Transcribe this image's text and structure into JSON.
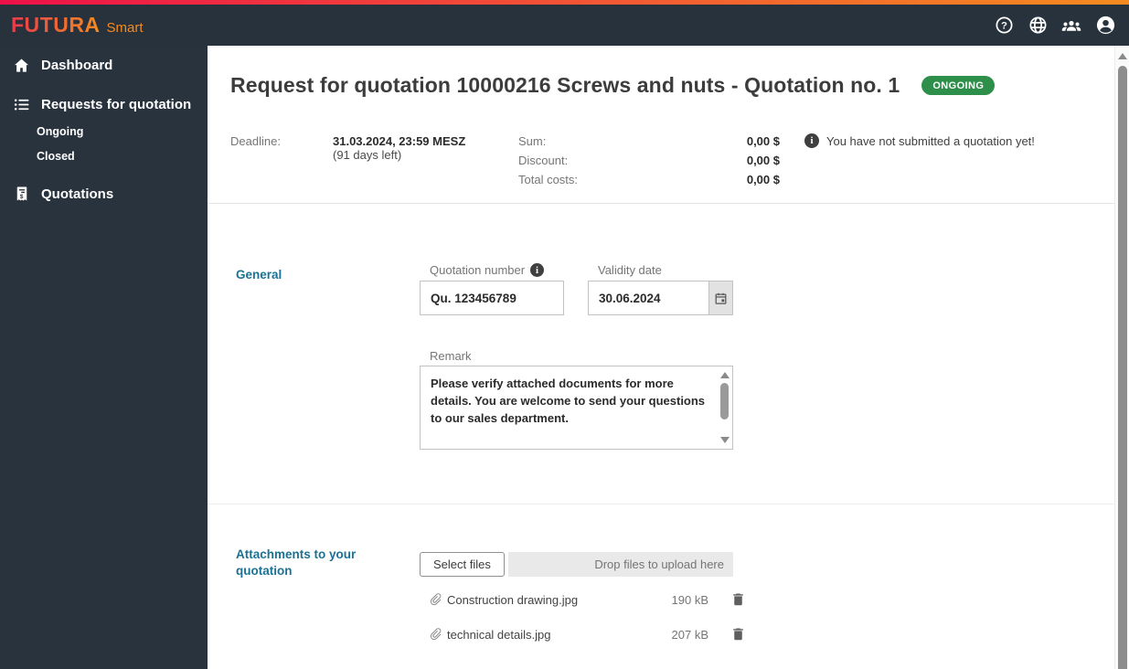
{
  "colors": {
    "topbar_bg": "#28323c",
    "sidebar_bg": "#28333e",
    "gradient_from": "#ee1149",
    "gradient_to": "#f68b1f",
    "brand_orange": "#f68b1f",
    "section_heading_teal": "#1b7294",
    "badge_green": "#2e8f4a"
  },
  "topbar": {
    "brand": "FUTURA",
    "brand_suffix": "Smart",
    "icons": [
      "help-icon",
      "globe-icon",
      "users-icon",
      "account-icon"
    ]
  },
  "sidebar": {
    "dashboard": {
      "label": "Dashboard",
      "icon": "home-icon"
    },
    "requests": {
      "label": "Requests for quotation",
      "icon": "list-icon"
    },
    "requests_children": [
      {
        "label": "Ongoing"
      },
      {
        "label": "Closed"
      }
    ],
    "quotations": {
      "label": "Quotations",
      "icon": "receipt-icon"
    }
  },
  "main": {
    "title": "Request for quotation 10000216 Screws and nuts - Quotation no. 1",
    "status_badge": "ONGOING",
    "summary": {
      "deadline_label": "Deadline:",
      "deadline_value": "31.03.2024, 23:59 MESZ",
      "deadline_note": "(91 days left)",
      "rows": [
        {
          "label": "Sum:",
          "value": "0,00 $"
        },
        {
          "label": "Discount:",
          "value": "0,00 $"
        },
        {
          "label": "Total costs:",
          "value": "0,00 $"
        }
      ],
      "notice": "You have not submitted a quotation yet!"
    },
    "general": {
      "section_title": "General",
      "quotation_number": {
        "label": "Quotation number",
        "value": "Qu. 123456789"
      },
      "validity_date": {
        "label": "Validity date",
        "value": "30.06.2024"
      },
      "remark": {
        "label": "Remark",
        "value": "Please verify attached documents for more details. You are welcome to send your questions to our sales department."
      }
    },
    "attachments": {
      "section_title": "Attachments to your quotation",
      "select_button": "Select files",
      "dropzone_text": "Drop files to upload here",
      "files": [
        {
          "name": "Construction drawing.jpg",
          "size": "190 kB"
        },
        {
          "name": "technical details.jpg",
          "size": "207 kB"
        }
      ]
    }
  }
}
